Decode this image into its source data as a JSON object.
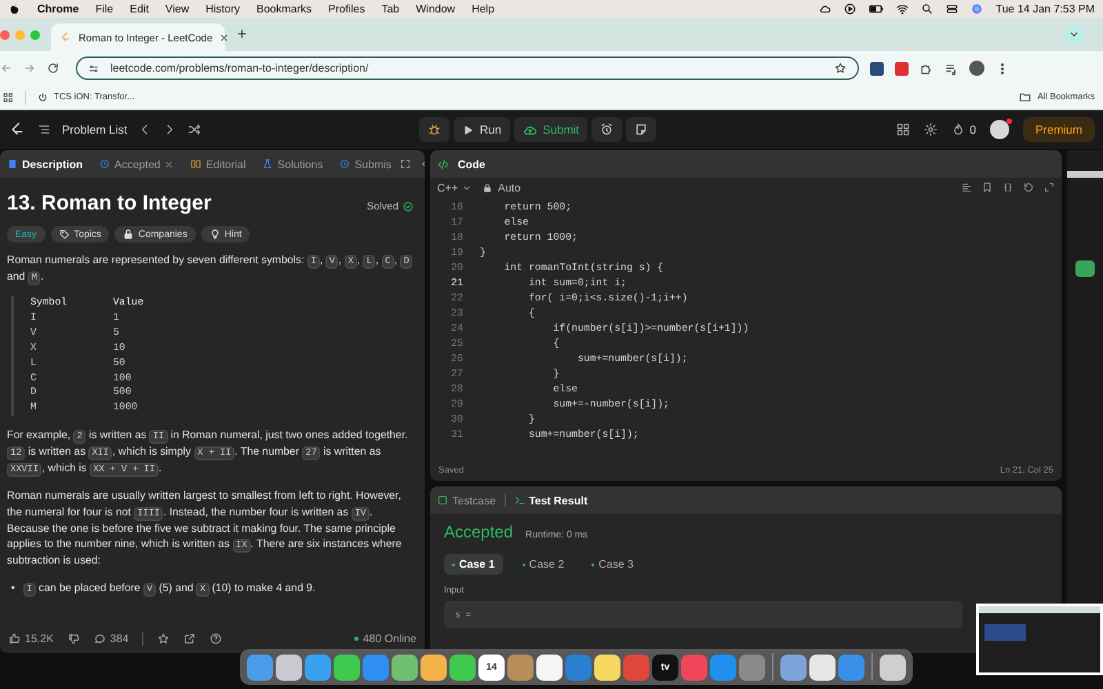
{
  "menu_bar": {
    "items": [
      {
        "label": "Chrome",
        "bold": true
      },
      {
        "label": "File",
        "bold": false
      },
      {
        "label": "Edit",
        "bold": false
      },
      {
        "label": "View",
        "bold": false
      },
      {
        "label": "History",
        "bold": false
      },
      {
        "label": "Bookmarks",
        "bold": false
      },
      {
        "label": "Profiles",
        "bold": false
      },
      {
        "label": "Tab",
        "bold": false
      },
      {
        "label": "Window",
        "bold": false
      },
      {
        "label": "Help",
        "bold": false
      }
    ],
    "clock": "Tue 14 Jan  7:53 PM"
  },
  "browser": {
    "tab_title": "Roman to Integer - LeetCode",
    "url": "leetcode.com/problems/roman-to-integer/description/",
    "bookmarks": [
      "TCS iON: Transfor..."
    ],
    "all_bookmarks": "All Bookmarks"
  },
  "top_bar": {
    "problem_list": "Problem List",
    "run": "Run",
    "submit": "Submit",
    "streak": "0",
    "premium": "Premium"
  },
  "left_tabs": [
    {
      "label": "Description",
      "selected": true,
      "closable": false
    },
    {
      "label": "Accepted",
      "selected": false,
      "closable": true
    },
    {
      "label": "Editorial",
      "selected": false,
      "closable": false
    },
    {
      "label": "Solutions",
      "selected": false,
      "closable": false
    },
    {
      "label": "Submis",
      "selected": false,
      "closable": false
    }
  ],
  "problem": {
    "title": "13. Roman to Integer",
    "status": "Solved",
    "tags": [
      {
        "label": "Easy",
        "kind": "difficulty"
      },
      {
        "label": "Topics",
        "kind": "tag"
      },
      {
        "label": "Companies",
        "kind": "lock"
      },
      {
        "label": "Hint",
        "kind": "bulb"
      }
    ],
    "intro": [
      {
        "text": "Roman numerals are represented by seven different symbols: ",
        "kind": "text"
      },
      {
        "text": "I",
        "kind": "code"
      },
      {
        "text": ", ",
        "kind": "text"
      },
      {
        "text": "V",
        "kind": "code"
      },
      {
        "text": ", ",
        "kind": "text"
      },
      {
        "text": "X",
        "kind": "code"
      },
      {
        "text": ", ",
        "kind": "text"
      },
      {
        "text": "L",
        "kind": "code"
      },
      {
        "text": ", ",
        "kind": "text"
      },
      {
        "text": "C",
        "kind": "code"
      },
      {
        "text": ", ",
        "kind": "text"
      },
      {
        "text": "D",
        "kind": "code"
      },
      {
        "text": " and ",
        "kind": "text"
      },
      {
        "text": "M",
        "kind": "code"
      },
      {
        "text": ".",
        "kind": "text"
      }
    ],
    "table_header": [
      "Symbol",
      "Value"
    ],
    "table_rows": [
      [
        "I",
        "1"
      ],
      [
        "V",
        "5"
      ],
      [
        "X",
        "10"
      ],
      [
        "L",
        "50"
      ],
      [
        "C",
        "100"
      ],
      [
        "D",
        "500"
      ],
      [
        "M",
        "1000"
      ]
    ],
    "paragraphs": [
      [
        {
          "text": "For example, ",
          "kind": "text"
        },
        {
          "text": "2",
          "kind": "code"
        },
        {
          "text": " is written as ",
          "kind": "text"
        },
        {
          "text": "II",
          "kind": "code"
        },
        {
          "text": " in Roman numeral, just two ones added together. ",
          "kind": "text"
        },
        {
          "text": "12",
          "kind": "code"
        },
        {
          "text": " is written as ",
          "kind": "text"
        },
        {
          "text": "XII",
          "kind": "code"
        },
        {
          "text": ", which is simply ",
          "kind": "text"
        },
        {
          "text": "X + II",
          "kind": "code"
        },
        {
          "text": ". The number ",
          "kind": "text"
        },
        {
          "text": "27",
          "kind": "code"
        },
        {
          "text": " is written as ",
          "kind": "text"
        },
        {
          "text": "XXVII",
          "kind": "code"
        },
        {
          "text": ", which is ",
          "kind": "text"
        },
        {
          "text": "XX + V + II",
          "kind": "code"
        },
        {
          "text": ".",
          "kind": "text"
        }
      ],
      [
        {
          "text": "Roman numerals are usually written largest to smallest from left to right. However, the numeral for four is not ",
          "kind": "text"
        },
        {
          "text": "IIII",
          "kind": "code"
        },
        {
          "text": ". Instead, the number four is written as ",
          "kind": "text"
        },
        {
          "text": "IV",
          "kind": "code"
        },
        {
          "text": ". Because the one is before the five we subtract it making four. The same principle applies to the number nine, which is written as ",
          "kind": "text"
        },
        {
          "text": "IX",
          "kind": "code"
        },
        {
          "text": ". There are six instances where subtraction is used:",
          "kind": "text"
        }
      ]
    ],
    "bullets": [
      {
        "marker": "•",
        "segments": [
          {
            "text": "I",
            "kind": "code"
          },
          {
            "text": " can be placed before ",
            "kind": "text"
          },
          {
            "text": "V",
            "kind": "code"
          },
          {
            "text": " (5) and ",
            "kind": "text"
          },
          {
            "text": "X",
            "kind": "code"
          },
          {
            "text": " (10) to make 4 and 9.",
            "kind": "text"
          }
        ]
      }
    ]
  },
  "footer": {
    "likes": "15.2K",
    "comments": "384",
    "online": "480 Online"
  },
  "code_panel": {
    "title": "Code",
    "language": "C++",
    "mode": "Auto",
    "lines": [
      {
        "number": "16",
        "text": "    return 500;",
        "current": false
      },
      {
        "number": "17",
        "text": "    else",
        "current": false
      },
      {
        "number": "18",
        "text": "    return 1000;",
        "current": false
      },
      {
        "number": "19",
        "text": "}",
        "current": false
      },
      {
        "number": "20",
        "text": "    int romanToInt(string s) {",
        "current": false
      },
      {
        "number": "21",
        "text": "        int sum=0;int i;",
        "current": true
      },
      {
        "number": "22",
        "text": "        for( i=0;i<s.size()-1;i++)",
        "current": false
      },
      {
        "number": "23",
        "text": "        {",
        "current": false
      },
      {
        "number": "24",
        "text": "            if(number(s[i])>=number(s[i+1]))",
        "current": false
      },
      {
        "number": "25",
        "text": "            {",
        "current": false
      },
      {
        "number": "26",
        "text": "                sum+=number(s[i]);",
        "current": false
      },
      {
        "number": "27",
        "text": "            }",
        "current": false
      },
      {
        "number": "28",
        "text": "            else",
        "current": false
      },
      {
        "number": "29",
        "text": "            sum+=-number(s[i]);",
        "current": false
      },
      {
        "number": "30",
        "text": "        }",
        "current": false
      },
      {
        "number": "31",
        "text": "        sum+=number(s[i]);",
        "current": false
      }
    ],
    "saved": "Saved",
    "position": "Ln 21, Col 25"
  },
  "test_panel": {
    "tabs": [
      {
        "label": "Testcase",
        "selected": false
      },
      {
        "label": "Test Result",
        "selected": true
      }
    ],
    "verdict": "Accepted",
    "runtime": "Runtime: 0 ms",
    "cases": [
      {
        "label": "Case 1",
        "selected": true
      },
      {
        "label": "Case 2",
        "selected": false
      },
      {
        "label": "Case 3",
        "selected": false
      }
    ],
    "input_label": "Input",
    "input_value": "s ="
  },
  "dock": {
    "groups": [
      [
        {
          "color": "#4a9be8"
        },
        {
          "color": "#c9c9d2"
        },
        {
          "color": "#3aa0f0"
        },
        {
          "color": "#3ec94f"
        },
        {
          "color": "#2f8ff0"
        },
        {
          "color": "#6fbf6f"
        },
        {
          "color": "#f2b34a"
        },
        {
          "color": "#3ec94f"
        },
        {
          "color": "#ffffff",
          "label": "14"
        },
        {
          "color": "#b88d5a"
        },
        {
          "color": "#f5f5f5"
        },
        {
          "color": "#2a7fd0"
        },
        {
          "color": "#f6d860"
        },
        {
          "color": "#e0463a"
        },
        {
          "color": "#111111",
          "label": "tv"
        },
        {
          "color": "#f0455a"
        },
        {
          "color": "#1f8ff0"
        },
        {
          "color": "#8a8a8a"
        }
      ],
      [
        {
          "color": "#7ea3d8"
        },
        {
          "color": "#e6e6e6"
        },
        {
          "color": "#3a8fe8"
        }
      ],
      [
        {
          "color": "#cfcfcf"
        }
      ]
    ]
  }
}
